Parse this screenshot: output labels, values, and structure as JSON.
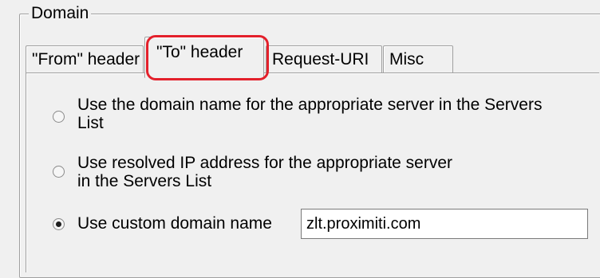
{
  "group": {
    "title": "Domain"
  },
  "tabs": [
    {
      "label": "\"From\" header"
    },
    {
      "label": "\"To\" header",
      "active": true
    },
    {
      "label": "Request-URI"
    },
    {
      "label": "Misc"
    }
  ],
  "colors": {
    "highlight": "#e3202b",
    "window_bg": "#f0f0f0"
  },
  "options": [
    {
      "line1": "Use the domain name for the appropriate server in the Servers",
      "line2": "List",
      "checked": false
    },
    {
      "line1": "Use resolved IP address for the appropriate server",
      "line2": "in the Servers List",
      "checked": false
    },
    {
      "line1": "Use custom domain name",
      "checked": true
    }
  ],
  "custom_domain": {
    "value": "zlt.proximiti.com"
  }
}
